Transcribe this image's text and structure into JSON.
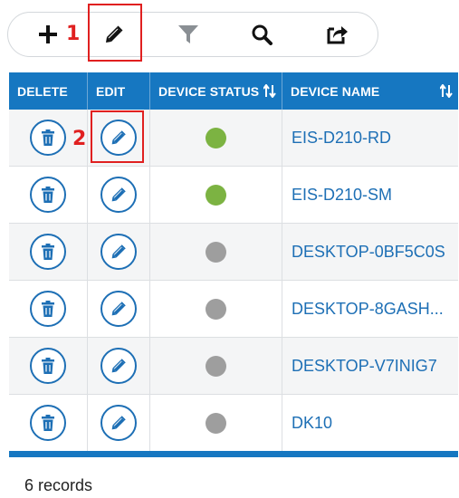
{
  "toolbar": {
    "buttons": [
      {
        "name": "add",
        "icon": "plus-icon"
      },
      {
        "name": "edit",
        "icon": "pencil-icon"
      },
      {
        "name": "filter",
        "icon": "filter-icon"
      },
      {
        "name": "search",
        "icon": "search-icon"
      },
      {
        "name": "export",
        "icon": "share-export-icon"
      }
    ]
  },
  "annotations": {
    "marker_1": "1",
    "marker_2": "2",
    "color": "#e02020"
  },
  "table": {
    "columns": [
      "DELETE",
      "EDIT",
      "DEVICE STATUS",
      "DEVICE NAME"
    ],
    "header_color": "#1677c1",
    "rows": [
      {
        "device_status": "online",
        "device_name": "EIS-D210-RD"
      },
      {
        "device_status": "online",
        "device_name": "EIS-D210-SM"
      },
      {
        "device_status": "offline",
        "device_name": "DESKTOP-0BF5C0S"
      },
      {
        "device_status": "offline",
        "device_name": "DESKTOP-8GASH..."
      },
      {
        "device_status": "offline",
        "device_name": "DESKTOP-V7INIG7"
      },
      {
        "device_status": "offline",
        "device_name": "DK10"
      }
    ],
    "status_colors": {
      "online": "#7cb342",
      "offline": "#9e9e9e"
    }
  },
  "footer": {
    "record_count": "6 records"
  }
}
